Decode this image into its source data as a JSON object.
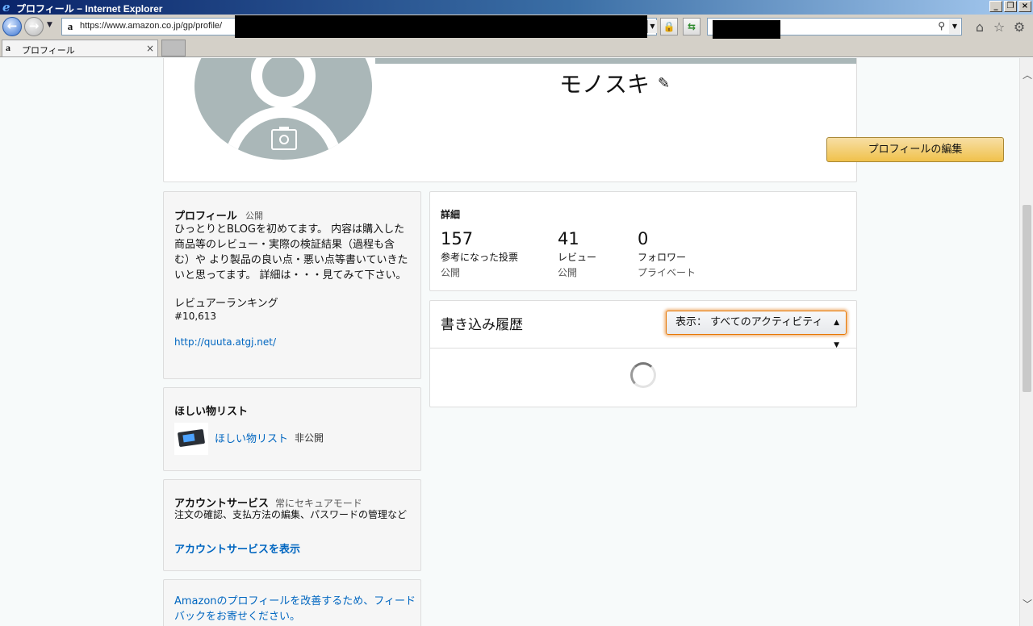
{
  "window": {
    "title": "プロフィール − Internet Explorer"
  },
  "address_bar": {
    "url": "https://www.amazon.co.jp/gp/profile/"
  },
  "tabs": [
    {
      "label": "プロフィール"
    }
  ],
  "profile": {
    "name": "モノスキ",
    "edit_button": "プロフィールの編集"
  },
  "about": {
    "title": "プロフィール",
    "visibility": "公開",
    "bio_lines": [
      "ひっとりとBLOGを初めてます。 内容は購入した",
      "商品等のレビュー・実際の検証結果（過程も含",
      "む）や より製品の良い点・悪い点等書いていきた",
      "いと思ってます。 詳細は・・・見てみて下さい。"
    ],
    "ranking_label": "レビュアーランキング",
    "ranking_value": "#10,613",
    "link": "http://quuta.atgj.net/"
  },
  "wishlist": {
    "title": "ほしい物リスト",
    "item_label": "ほしい物リスト",
    "item_visibility": "非公開"
  },
  "account": {
    "title": "アカウントサービス",
    "secure": "常にセキュアモード",
    "description": "注文の確認、支払方法の編集、パスワードの管理など",
    "link": "アカウントサービスを表示"
  },
  "feedback": {
    "text": "Amazonのプロフィールを改善するため、フィードバックをお寄せください。"
  },
  "details": {
    "title": "詳細",
    "stats": [
      {
        "value": "157",
        "label": "参考になった投票",
        "visibility": "公開"
      },
      {
        "value": "41",
        "label": "レビュー",
        "visibility": "公開"
      },
      {
        "value": "0",
        "label": "フォロワー",
        "visibility": "プライベート"
      }
    ]
  },
  "activity": {
    "title": "書き込み履歴",
    "filter_value": "表示： すべてのアクティビティ"
  },
  "colors": {
    "link": "#0066c0",
    "button_yellow": "#f0c14b",
    "avatar_gray": "#aab7b8",
    "focus_orange": "#e77600"
  }
}
